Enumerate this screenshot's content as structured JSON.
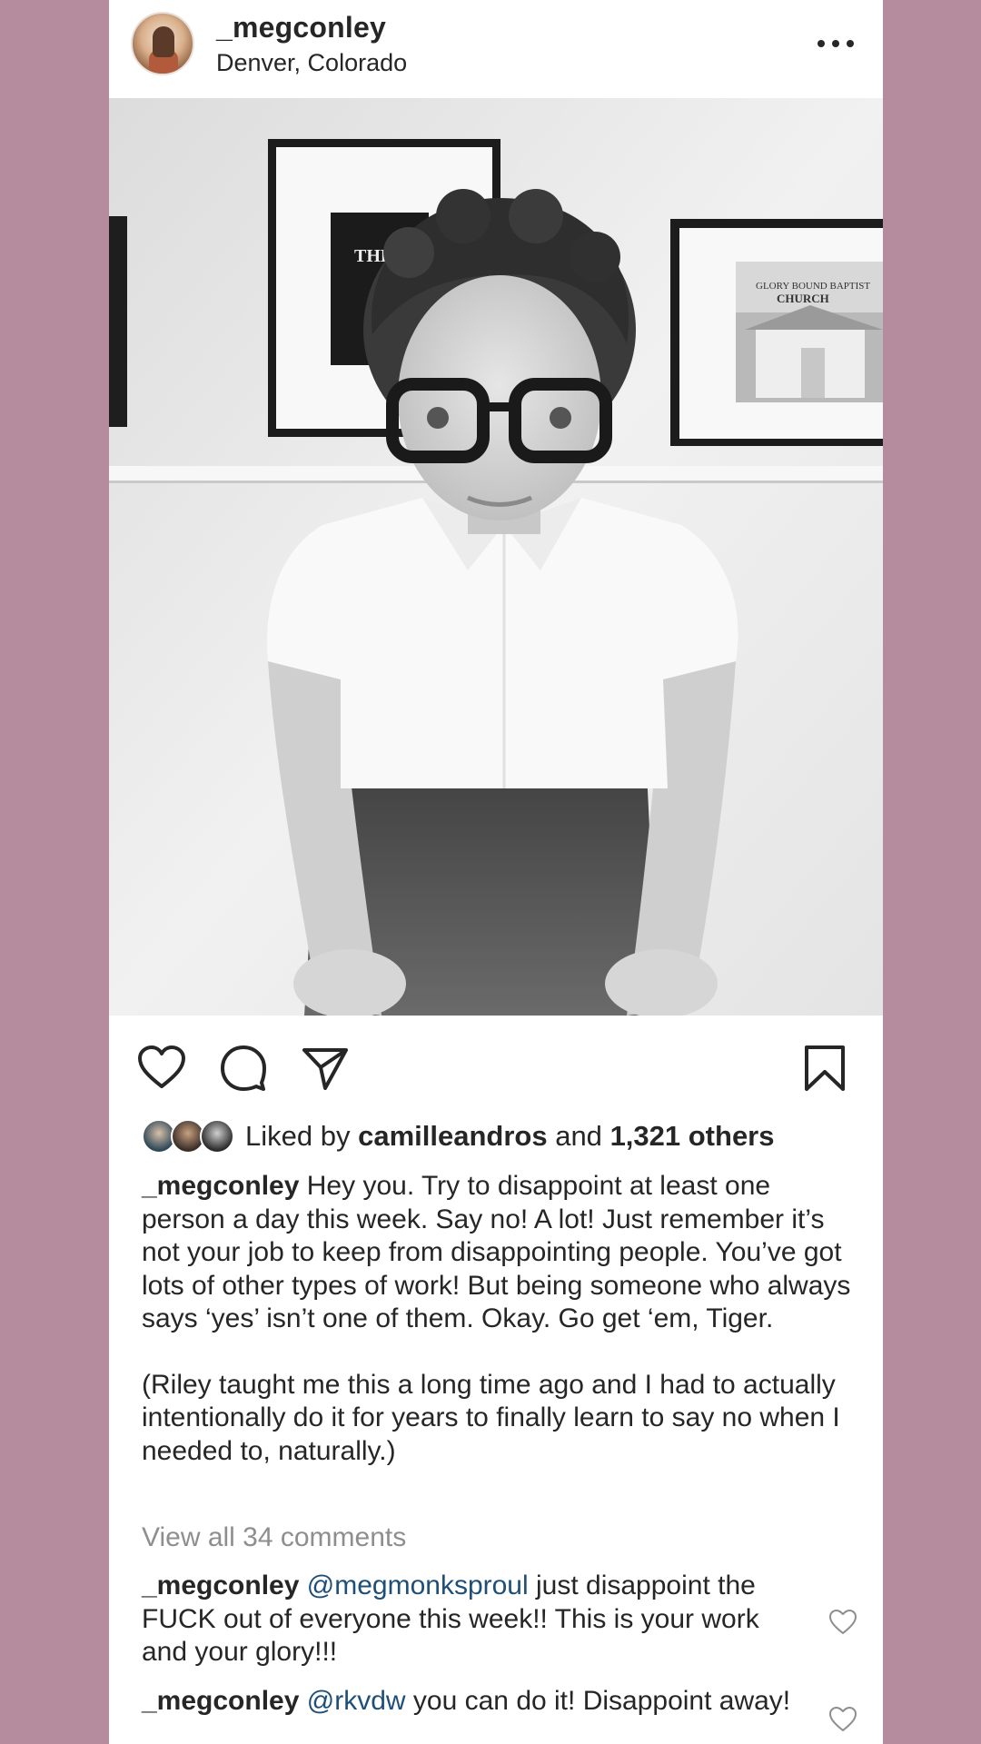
{
  "header": {
    "username": "_megconley",
    "location": "Denver, Colorado",
    "more_icon": "more-horizontal-icon"
  },
  "photo": {
    "description_icon": "post-photo",
    "wall_sign_left": "THE COU LI",
    "wall_sign_right_line1": "GLORY BOUND BAPTIST",
    "wall_sign_right_line2": "CHURCH"
  },
  "actions": {
    "like_icon": "heart-icon",
    "comment_icon": "comment-icon",
    "share_icon": "send-icon",
    "save_icon": "bookmark-icon"
  },
  "likes": {
    "prefix": "Liked by",
    "user": "camilleandros",
    "middle": "and",
    "others": "1,321 others"
  },
  "caption": {
    "username": "_megconley",
    "text1": "Hey you. Try to disappoint at least one person a day this week. Say no! A lot! Just remember it’s not your job to keep from disappointing people. You’ve got lots of other types of work! But being someone who always says ‘yes’ isn’t one of them. Okay. Go get ‘em, Tiger.",
    "text2": "(Riley taught me this a long time ago and I had to actually intentionally do it for years to finally learn to say no when I needed to, naturally.)"
  },
  "view_all_comments": "View all 34 comments",
  "comments": [
    {
      "username": "_megconley",
      "mention": "@megmonksproul",
      "text": "just disappoint the FUCK out of everyone this week!! This is your work and your glory!!!"
    },
    {
      "username": "_megconley",
      "mention": "@rkvdw",
      "text": "you can do it! Disappoint away!"
    }
  ],
  "colors": {
    "background": "#b48c9e",
    "card": "#ffffff",
    "text": "#262626",
    "muted": "#8e8e8e",
    "mention": "#1e4f7a"
  }
}
